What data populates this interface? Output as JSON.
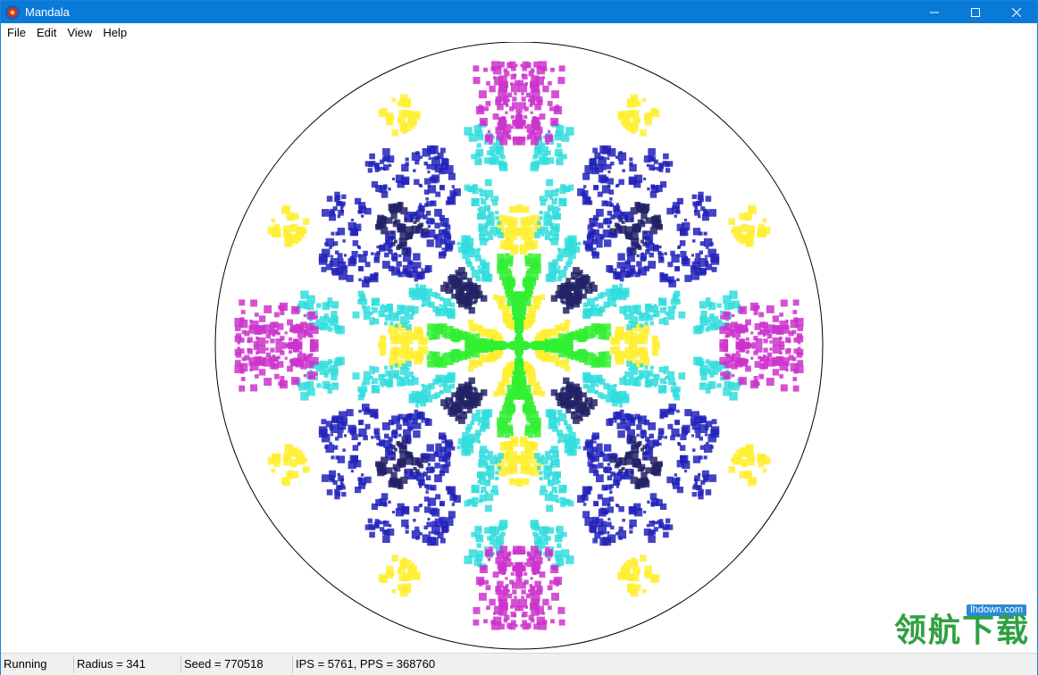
{
  "window": {
    "title": "Mandala",
    "minimize_glyph": "—",
    "maximize_glyph": "☐",
    "close_glyph": "✕"
  },
  "menu": {
    "items": [
      {
        "label": "File"
      },
      {
        "label": "Edit"
      },
      {
        "label": "View"
      },
      {
        "label": "Help"
      }
    ]
  },
  "status": {
    "state": "Running",
    "radius": "Radius = 341",
    "seed": "Seed = 770518",
    "rates": "IPS = 5761, PPS = 368760"
  },
  "watermark": {
    "site": "lhdown.com",
    "brand": "领航下载"
  },
  "mandala": {
    "palette": [
      "#cc33cc",
      "#ffee33",
      "#2222bb",
      "#33dddd",
      "#33ee33",
      "#222266"
    ],
    "seed": 770518,
    "radius": 341
  }
}
